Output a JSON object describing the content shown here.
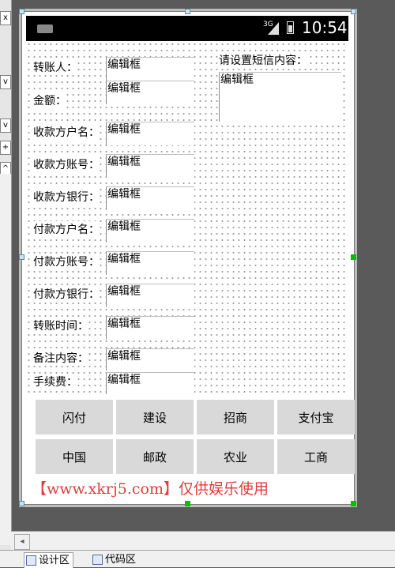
{
  "status_bar": {
    "network": "3G",
    "time": "10:54"
  },
  "form": {
    "placeholder": "编辑框",
    "fields": [
      {
        "label": "转账人：",
        "value": "编辑框"
      },
      {
        "label": "金额：",
        "value": "编辑框"
      },
      {
        "label": "收款方户名：",
        "value": "编辑框"
      },
      {
        "label": "收款方账号：",
        "value": "编辑框"
      },
      {
        "label": "收款方银行：",
        "value": "编辑框"
      },
      {
        "label": "付款方户名：",
        "value": "编辑框"
      },
      {
        "label": "付款方账号：",
        "value": "编辑框"
      },
      {
        "label": "付款方银行：",
        "value": "编辑框"
      },
      {
        "label": "转账时间：",
        "value": "编辑框"
      },
      {
        "label": "备注内容：",
        "value": "编辑框"
      },
      {
        "label": "手续费：",
        "value": "编辑框"
      }
    ],
    "sms": {
      "label": "请设置短信内容：",
      "value": "编辑框"
    }
  },
  "buttons": {
    "row1": [
      "闪付",
      "建设",
      "招商",
      "支付宝"
    ],
    "row2": [
      "中国",
      "邮政",
      "农业",
      "工商"
    ]
  },
  "footer_text": "【www.xkrj5.com】仅供娱乐使用",
  "editor_tabs": [
    "设计区",
    "代码区"
  ],
  "left_strip": [
    "x",
    "v",
    "v",
    "+",
    "^"
  ],
  "colors": {
    "status_bar": "#000000",
    "button": "#d9d9d9",
    "footer": "#e23b3b",
    "selection_handle": "#00c000"
  }
}
